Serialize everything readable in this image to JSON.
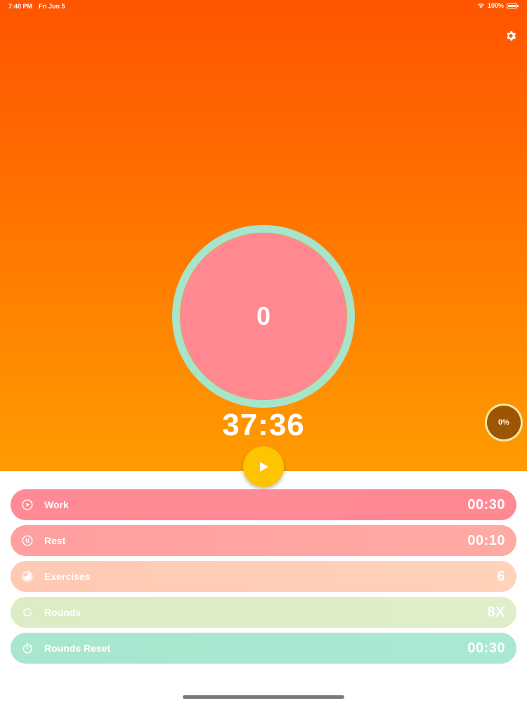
{
  "status_bar": {
    "time": "7:40 PM",
    "date": "Fri Jun 5",
    "battery": "100%",
    "icons": [
      "wifi-icon",
      "battery-icon"
    ]
  },
  "header": {
    "settings_icon": "gear-icon"
  },
  "timer": {
    "current_count": "0",
    "total_time": "37:36",
    "progress_label": "0%",
    "progress_fraction": 0
  },
  "controls": {
    "play_icon": "play-icon"
  },
  "settings": [
    {
      "key": "work",
      "label": "Work",
      "value": "00:30",
      "icon": "play-circle-icon"
    },
    {
      "key": "rest",
      "label": "Rest",
      "value": "00:10",
      "icon": "pause-circle-icon"
    },
    {
      "key": "exercises",
      "label": "Exercises",
      "value": "6",
      "icon": "pie-icon"
    },
    {
      "key": "rounds",
      "label": "Rounds",
      "value": "8X",
      "icon": "refresh-icon"
    },
    {
      "key": "rounds_reset",
      "label": "Rounds Reset",
      "value": "00:30",
      "icon": "stopwatch-icon"
    }
  ],
  "colors": {
    "hero_top": "#ff5400",
    "hero_bottom": "#ff9c00",
    "ring": "#a7e4cc",
    "circle_fill": "#ff8891",
    "play_button": "#ffc400",
    "progress_badge": "#9e5503",
    "work": "#ff8a95",
    "rest": "#ffa5a1",
    "exercises": "#ffcdb6",
    "rounds": "#ddedc6",
    "rounds_reset": "#a9e7d0"
  }
}
